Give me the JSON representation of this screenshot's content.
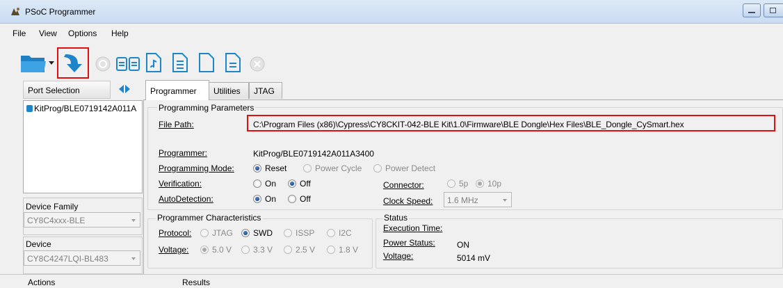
{
  "window": {
    "title": "PSoC Programmer"
  },
  "menu": [
    "File",
    "View",
    "Options",
    "Help"
  ],
  "toolbar": {
    "icons": [
      "open-folder-icon",
      "dropdown-arrow-icon",
      "program-icon",
      "halt-icon",
      "verify-icon",
      "read-icon",
      "erase-icon",
      "checksum-icon",
      "blank-check-icon",
      "stop-icon"
    ],
    "accent": "#1e86c8",
    "highlight": "#e01010"
  },
  "left": {
    "port_header": "Port Selection",
    "ports": [
      "KitProg/BLE0719142A011A"
    ],
    "device_family_label": "Device Family",
    "device_family_value": "CY8C4xxx-BLE",
    "device_label": "Device",
    "device_value": "CY8C4247LQI-BL483"
  },
  "tabs": [
    "Programmer",
    "Utilities",
    "JTAG"
  ],
  "programming_parameters": {
    "title": "Programming Parameters",
    "file_path_label": "File Path:",
    "file_path_value": "C:\\Program Files (x86)\\Cypress\\CY8CKIT-042-BLE Kit\\1.0\\Firmware\\BLE Dongle\\Hex Files\\BLE_Dongle_CySmart.hex",
    "programmer_label": "Programmer:",
    "programmer_value": "KitProg/BLE0719142A011A3400",
    "mode_label": "Programming Mode:",
    "mode_options": [
      "Reset",
      "Power Cycle",
      "Power Detect"
    ],
    "mode_selected": "Reset",
    "verification_label": "Verification:",
    "verification_options": [
      "On",
      "Off"
    ],
    "verification_selected": "Off",
    "autodetection_label": "AutoDetection:",
    "autodetection_options": [
      "On",
      "Off"
    ],
    "autodetection_selected": "On",
    "connector_label": "Connector:",
    "connector_options": [
      "5p",
      "10p"
    ],
    "connector_selected": "10p",
    "clock_label": "Clock Speed:",
    "clock_value": "1.6 MHz"
  },
  "programmer_characteristics": {
    "title": "Programmer Characteristics",
    "protocol_label": "Protocol:",
    "protocol_options": [
      "JTAG",
      "SWD",
      "ISSP",
      "I2C"
    ],
    "protocol_selected": "SWD",
    "voltage_label": "Voltage:",
    "voltage_options": [
      "5.0 V",
      "3.3 V",
      "2.5 V",
      "1.8 V"
    ],
    "voltage_selected": "5.0 V"
  },
  "status": {
    "title": "Status",
    "execution_time_label": "Execution Time:",
    "power_status_label": "Power Status:",
    "power_status_value": "ON",
    "voltage_label": "Voltage:",
    "voltage_value": "5014 mV"
  },
  "bottom": {
    "actions_label": "Actions",
    "results_label": "Results"
  }
}
